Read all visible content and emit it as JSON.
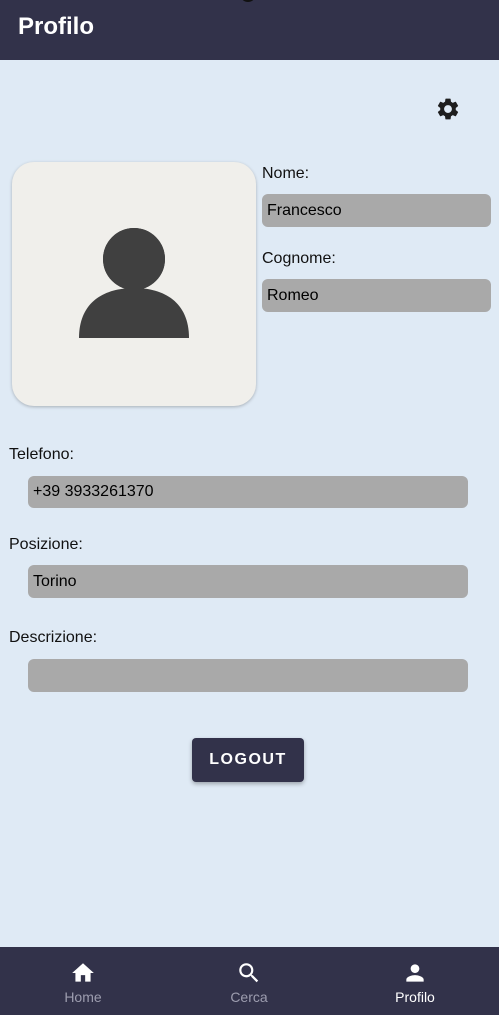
{
  "header": {
    "title": "Profilo"
  },
  "settings": {
    "icon": "gear-icon"
  },
  "avatar": {
    "icon": "person-icon"
  },
  "fields": {
    "nome": {
      "label": "Nome:",
      "value": "Francesco"
    },
    "cognome": {
      "label": "Cognome:",
      "value": "Romeo"
    },
    "telefono": {
      "label": "Telefono:",
      "value": "+39 3933261370"
    },
    "posizione": {
      "label": "Posizione:",
      "value": "Torino"
    },
    "descrizione": {
      "label": "Descrizione:",
      "value": ""
    }
  },
  "logout": {
    "label": "LOGOUT"
  },
  "bottom_nav": {
    "items": [
      {
        "label": "Home",
        "icon": "home-icon",
        "active": false
      },
      {
        "label": "Cerca",
        "icon": "search-icon",
        "active": false
      },
      {
        "label": "Profilo",
        "icon": "person-icon",
        "active": true
      }
    ]
  },
  "colors": {
    "primary": "#32324a",
    "background": "#dfeaf5",
    "field": "#a9a9a9",
    "nav_inactive": "#9d9daf",
    "nav_active": "#ffffff"
  }
}
